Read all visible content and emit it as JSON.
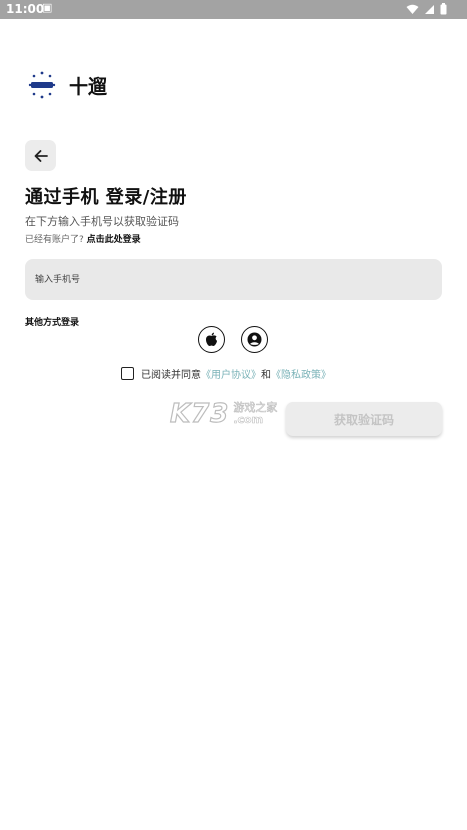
{
  "status_bar": {
    "time": "11:00",
    "background_color": "#a3a3a3"
  },
  "app": {
    "name": "十遛",
    "logo_icon": "sun-bar-logo-icon",
    "logo_color": "#1f3a8a"
  },
  "header": {
    "back_icon": "arrow-left-icon"
  },
  "login": {
    "title": "通过手机 登录/注册",
    "subtitle": "在下方输入手机号以获取验证码",
    "have_account_text": "已经有账户了?",
    "login_link": "点击此处登录"
  },
  "phone": {
    "placeholder": "输入手机号",
    "value": ""
  },
  "other_login": {
    "label": "其他方式登录",
    "options": [
      {
        "name": "Apple",
        "icon": "apple-icon"
      },
      {
        "name": "Account",
        "icon": "user-circle-icon"
      }
    ]
  },
  "agreement": {
    "checked": false,
    "prefix": "已阅读并同意",
    "user_agreement": "《用户协议》",
    "and": "和",
    "privacy_policy": "《隐私政策》",
    "link_color": "#7bb3b8"
  },
  "watermark": {
    "big": "K73",
    "cn": "游戏之家",
    "com": ".com"
  },
  "actions": {
    "get_code_label": "获取验证码",
    "enabled": false
  }
}
